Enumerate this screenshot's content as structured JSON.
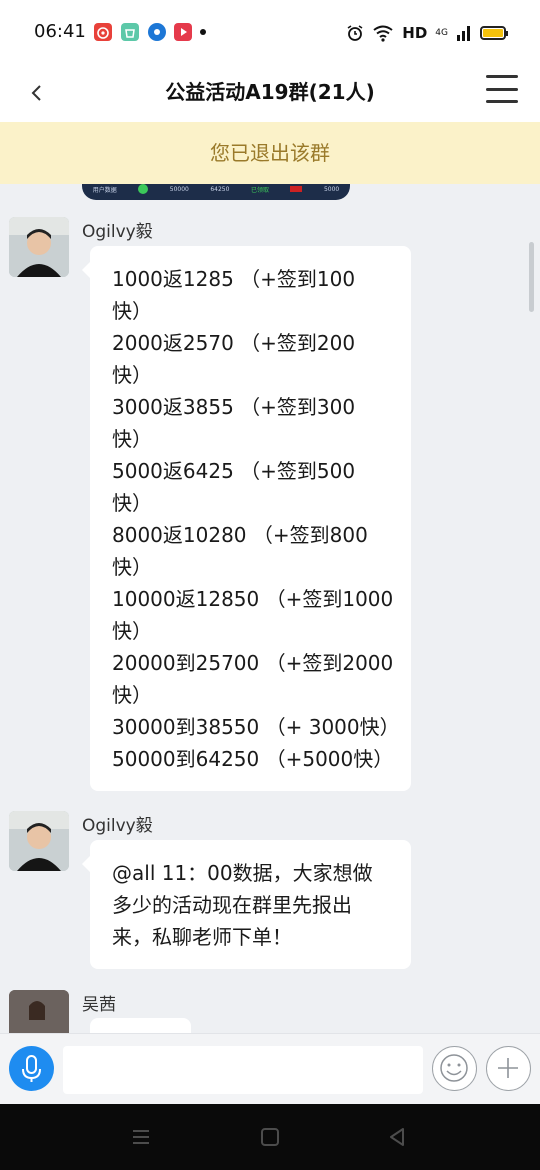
{
  "status_bar": {
    "time": "06:41",
    "hd_label": "HD",
    "network_label": "4G",
    "notification_icons": [
      "weibo-app-icon",
      "shop-app-icon",
      "circle-app-icon",
      "video-app-icon"
    ],
    "icons": [
      "alarm-icon",
      "wifi-icon",
      "signal-icon",
      "battery-icon"
    ]
  },
  "nav": {
    "title": "公益活动A19群(21人)",
    "back_icon": "chevron-left-icon",
    "menu_icon": "hamburger-menu-icon"
  },
  "banner": {
    "text": "您已退出该群"
  },
  "image_strip": {
    "cells": [
      "用户数据",
      "50000",
      "64250",
      "已领取",
      "5000"
    ]
  },
  "messages": [
    {
      "sender": "Ogilvy毅",
      "lines": [
        "1000返1285 （+签到100",
        "快）",
        "2000返2570 （+签到200",
        "快）",
        "3000返3855 （+签到300",
        "快）",
        "5000返6425 （+签到500",
        "快）",
        "8000返10280 （+签到800",
        "快）",
        "10000返12850 （+签到1000",
        "快）",
        "20000到25700 （+签到2000",
        "快）",
        "30000到38550 （+ 3000快）",
        "50000到64250 （+5000快）"
      ]
    },
    {
      "sender": "Ogilvy毅",
      "lines": [
        "@all 11：00数据，大家想做",
        "多少的活动现在群里先报出",
        "来，私聊老师下单！"
      ]
    },
    {
      "sender": "吴茜",
      "lines": []
    }
  ],
  "input_bar": {
    "placeholder": "",
    "mic_icon": "microphone-icon",
    "emoji_icon": "emoji-icon",
    "plus_icon": "plus-icon"
  },
  "system_nav": {
    "icons": [
      "recent-apps-icon",
      "home-icon",
      "back-triangle-icon"
    ]
  },
  "colors": {
    "banner_bg": "#fbf2c9",
    "banner_text": "#9a7a2a",
    "chat_bg": "#eef0f3",
    "mic_blue": "#1e8cf0"
  }
}
